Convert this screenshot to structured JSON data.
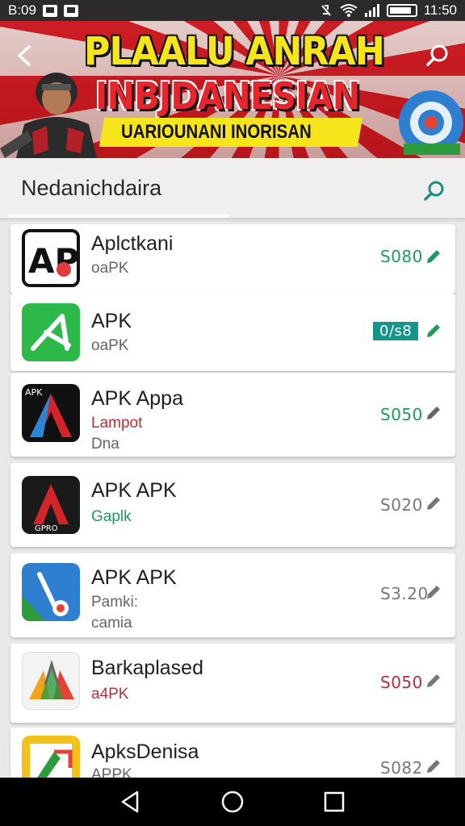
{
  "status_bar": {
    "time_left": "B:09",
    "time_right": "11:50",
    "icons": [
      "image-icon",
      "picture-icon",
      "mute-icon",
      "wifi-icon",
      "signal-icon",
      "battery-icon"
    ]
  },
  "banner": {
    "title_line1": "PLAALU ANRAH",
    "title_line2": "INBJDANESIAN",
    "subtitle": "UARIOUNANI INORISAN",
    "colors": {
      "red": "#d8212a",
      "yellow": "#f7e51c"
    }
  },
  "header": {
    "title": "Nedanichdaira"
  },
  "apps": [
    {
      "name": "Aplctkani",
      "sub1": "oaPK",
      "sub2": "",
      "price": "S080",
      "price_color": "#1f9a5c",
      "price_badge": false,
      "edit_color": "#1f9a5c",
      "icon_label": "AP"
    },
    {
      "name": "APK",
      "sub1": "oaPK",
      "sub2": "",
      "price": "0/s8",
      "price_color": "#ffffff",
      "price_badge": true,
      "edit_color": "#1f9a5c",
      "icon_label": ""
    },
    {
      "name": "APK Appa",
      "sub1": "Lampot",
      "sub2": "Dna",
      "price": "S050",
      "price_color": "#1f9a5c",
      "price_badge": false,
      "edit_color": "#666666",
      "icon_label": "APK"
    },
    {
      "name": "APK APK",
      "sub1": "Gaplk",
      "sub2": "",
      "price": "S020",
      "price_color": "#777777",
      "price_badge": false,
      "edit_color": "#777777",
      "icon_label": "GPRO"
    },
    {
      "name": "APK APK",
      "sub1": "Pamki:",
      "sub2": "camia",
      "price": "S3.20",
      "price_color": "#777777",
      "price_badge": false,
      "edit_color": "#777777",
      "icon_label": ""
    },
    {
      "name": "Barkaplased",
      "sub1": "a4PK",
      "sub2": "",
      "price": "S050",
      "price_color": "#b3303a",
      "price_badge": false,
      "edit_color": "#777777",
      "icon_label": ""
    },
    {
      "name": "ApksDenisa",
      "sub1": "APPK",
      "sub2": "",
      "price": "S082",
      "price_color": "#777777",
      "price_badge": false,
      "edit_color": "#777777",
      "icon_label": ""
    }
  ],
  "nav": {
    "icons": [
      "back-icon",
      "home-icon",
      "recents-icon"
    ]
  }
}
